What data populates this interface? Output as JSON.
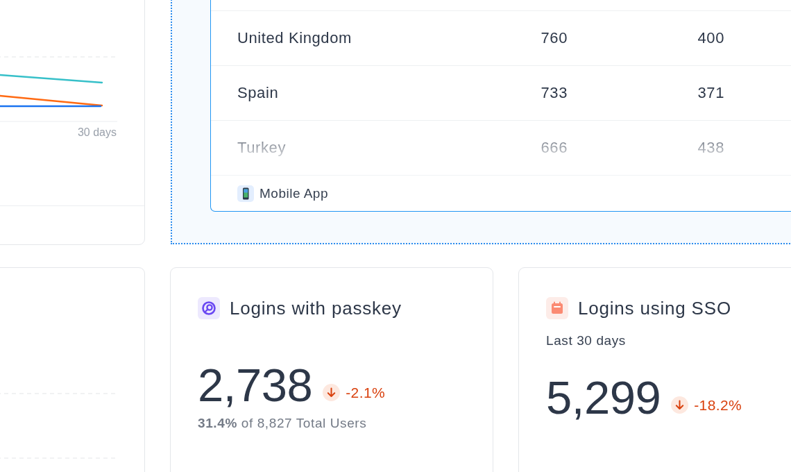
{
  "trend_card": {
    "axis_label": "30 days"
  },
  "country_table": {
    "rows": [
      {
        "cells": [
          "United Kingdom",
          "760",
          "400"
        ],
        "faded": false
      },
      {
        "cells": [
          "Spain",
          "733",
          "371"
        ],
        "faded": false
      },
      {
        "cells": [
          "Turkey",
          "666",
          "438"
        ],
        "faded": true
      }
    ],
    "footer_label": "Mobile App"
  },
  "stat_cards": [
    {
      "kind": "passkey",
      "title": "Logins with passkey",
      "value": "2,738",
      "change": {
        "decreasing": true,
        "text": "-2.1%"
      },
      "note": "**31.4%** of 8,827 Total Users"
    },
    {
      "kind": "sso",
      "title": "Logins using SSO",
      "subtitle": "Last 30 days",
      "value": "5,299",
      "change": {
        "decreasing": true,
        "text": "-18.2%"
      }
    }
  ]
}
